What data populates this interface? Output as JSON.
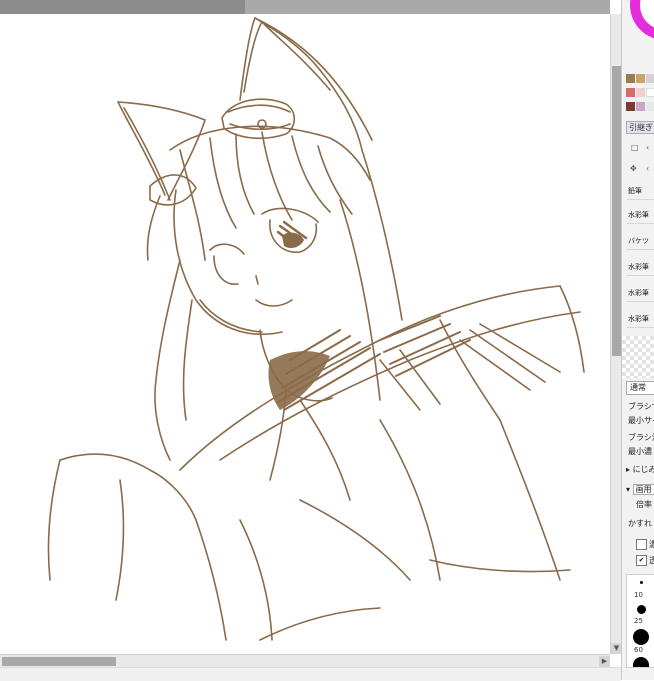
{
  "colors": {
    "stroke": "#8a6a49",
    "wheel_magenta": "#e62bdc",
    "swatches": [
      "#9b7a52",
      "#c7a56a",
      "#d2d2d2",
      "#d46b6b",
      "#eed0d0",
      "#ffffff",
      "#7a3b2e",
      "#c9a7c7",
      "#e8e8e8"
    ]
  },
  "panel": {
    "layer_button": "引継ぎ",
    "tools": [
      "鉛筆",
      "水彩筆",
      "バケツ",
      "水彩筆",
      "水彩筆",
      "水彩筆"
    ],
    "blend_mode": "通常",
    "props": [
      "ブラシサ",
      "最小サイ",
      "ブラシ濃",
      "最小濃"
    ],
    "expander1": "にじみ",
    "expander2_select": "画用",
    "expander2_sub": "倍率",
    "texture_label": "かすれ",
    "check1_label": "濃",
    "check2_label": "透",
    "brush_sizes": [
      "10",
      "25",
      "60"
    ]
  },
  "icons": {
    "select_rect": "select-rect-icon",
    "move": "move-icon"
  }
}
